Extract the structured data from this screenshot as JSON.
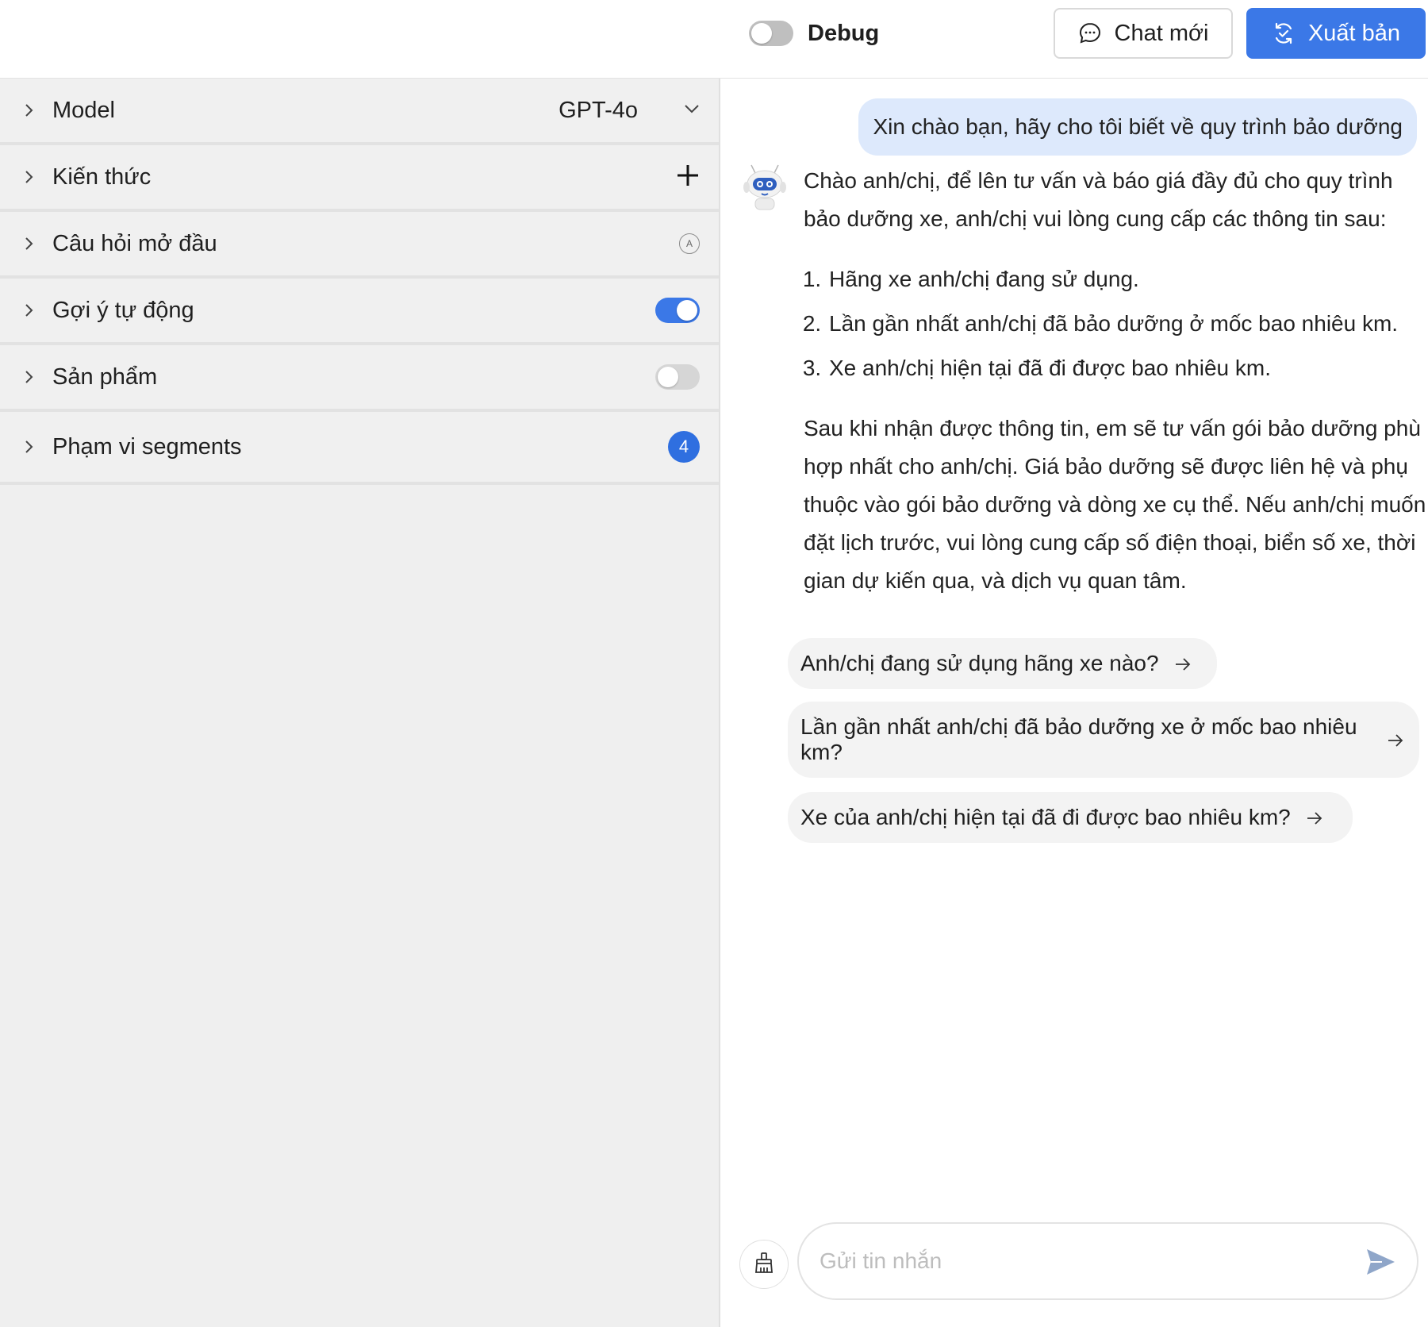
{
  "header": {
    "debug_label": "Debug",
    "debug_enabled": false,
    "new_chat_label": "Chat mới",
    "publish_label": "Xuất bản",
    "accent_color": "#3b78e7"
  },
  "settings": {
    "model": {
      "label": "Model",
      "value": "GPT-4o"
    },
    "knowledge": {
      "label": "Kiến thức"
    },
    "opening_questions": {
      "label": "Câu hỏi mở đầu",
      "icon_letter": "A"
    },
    "auto_suggest": {
      "label": "Gợi ý tự động",
      "enabled": true
    },
    "products": {
      "label": "Sản phẩm",
      "enabled": false
    },
    "segments": {
      "label": "Phạm vi segments",
      "count": "4"
    }
  },
  "chat": {
    "user_message": "Xin chào bạn, hãy cho tôi biết về quy trình bảo dưỡng",
    "bot_intro": "Chào anh/chị, để lên tư vấn và báo giá đầy đủ cho quy trình bảo dưỡng xe, anh/chị vui lòng cung cấp các thông tin sau:",
    "bot_list": [
      "Hãng xe anh/chị đang sử dụng.",
      "Lần gần nhất anh/chị đã bảo dưỡng ở mốc bao nhiêu km.",
      "Xe anh/chị hiện tại đã đi được bao nhiêu km."
    ],
    "bot_outro": "Sau khi nhận được thông tin, em sẽ tư vấn gói bảo dưỡng phù hợp nhất cho anh/chị. Giá bảo dưỡng sẽ được liên hệ và phụ thuộc vào gói bảo dưỡng và dòng xe cụ thể. Nếu anh/chị muốn đặt lịch trước, vui lòng cung cấp số điện thoại, biển số xe, thời gian dự kiến qua, và dịch vụ quan tâm.",
    "suggestions": [
      "Anh/chị đang sử dụng hãng xe nào?",
      "Lần gần nhất anh/chị đã bảo dưỡng xe ở mốc bao nhiêu km?",
      "Xe của anh/chị hiện tại đã đi được bao nhiêu km?"
    ],
    "input_placeholder": "Gửi tin nhắn"
  }
}
